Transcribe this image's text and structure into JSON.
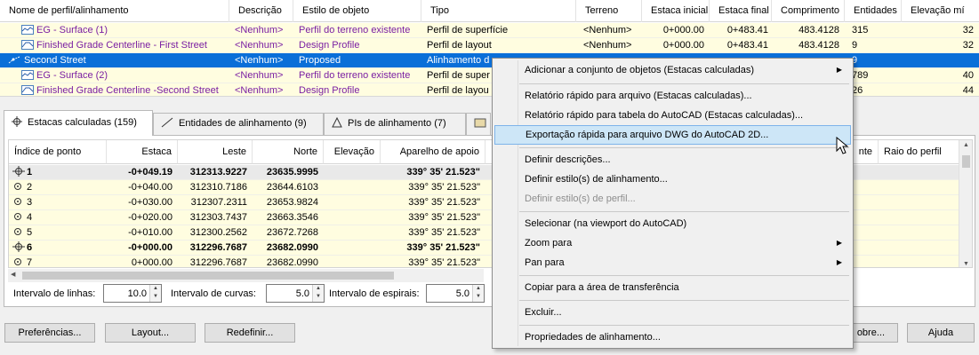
{
  "top_grid": {
    "columns": [
      "Nome de perfil/alinhamento",
      "Descrição",
      "Estilo de objeto",
      "Tipo",
      "Terreno",
      "Estaca inicial",
      "Estaca final",
      "Comprimento",
      "Entidades",
      "Elevação mí"
    ],
    "rows": [
      {
        "name": "EG - Surface (1)",
        "desc": "<Nenhum>",
        "style": "Perfil do terreno existente",
        "type": "Perfil de superfície",
        "terrain": "<Nenhum>",
        "start": "0+000.00",
        "end": "0+483.41",
        "length": "483.4128",
        "entities": "315",
        "elev": "32"
      },
      {
        "name": "Finished Grade Centerline - First Street",
        "desc": "<Nenhum>",
        "style": "Design Profile",
        "type": "Perfil de layout",
        "terrain": "<Nenhum>",
        "start": "0+000.00",
        "end": "0+483.41",
        "length": "483.4128",
        "entities": "9",
        "elev": "32"
      },
      {
        "name": "Second Street",
        "desc": "<Nenhum>",
        "style": "Proposed",
        "type": "Alinhamento d",
        "terrain": "",
        "start": "",
        "end": "",
        "length": "",
        "entities": "9",
        "elev": ""
      },
      {
        "name": "EG - Surface (2)",
        "desc": "<Nenhum>",
        "style": "Perfil do terreno existente",
        "type": "Perfil de super",
        "terrain": "",
        "start": "",
        "end": "",
        "length": "",
        "entities": "789",
        "elev": "40"
      },
      {
        "name": "Finished Grade Centerline -Second Street",
        "desc": "<Nenhum>",
        "style": "Design Profile",
        "type": "Perfil de layou",
        "terrain": "",
        "start": "",
        "end": "",
        "length": "",
        "entities": "26",
        "elev": "44"
      }
    ]
  },
  "tabs": [
    {
      "label": "Estacas calculadas (159)"
    },
    {
      "label": "Entidades de alinhamento (9)"
    },
    {
      "label": "PIs de alinhamento (7)"
    }
  ],
  "bottom_grid": {
    "columns": [
      "Índice de ponto",
      "Estaca",
      "Leste",
      "Norte",
      "Elevação",
      "Aparelho de apoio",
      "nte",
      "Raio do perfil"
    ],
    "rows": [
      {
        "index": "1",
        "station": "-0+049.19",
        "east": "312313.9227",
        "north": "23635.9995",
        "elev": "",
        "bearing": "339° 35' 21.523\"",
        "bold": true
      },
      {
        "index": "2",
        "station": "-0+040.00",
        "east": "312310.7186",
        "north": "23644.6103",
        "elev": "",
        "bearing": "339° 35' 21.523\"",
        "bold": false
      },
      {
        "index": "3",
        "station": "-0+030.00",
        "east": "312307.2311",
        "north": "23653.9824",
        "elev": "",
        "bearing": "339° 35' 21.523\"",
        "bold": false
      },
      {
        "index": "4",
        "station": "-0+020.00",
        "east": "312303.7437",
        "north": "23663.3546",
        "elev": "",
        "bearing": "339° 35' 21.523\"",
        "bold": false
      },
      {
        "index": "5",
        "station": "-0+010.00",
        "east": "312300.2562",
        "north": "23672.7268",
        "elev": "",
        "bearing": "339° 35' 21.523\"",
        "bold": false
      },
      {
        "index": "6",
        "station": "-0+000.00",
        "east": "312296.7687",
        "north": "23682.0990",
        "elev": "",
        "bearing": "339° 35' 21.523\"",
        "bold": true
      },
      {
        "index": "7",
        "station": "0+000.00",
        "east": "312296.7687",
        "north": "23682.0990",
        "elev": "",
        "bearing": "339° 35' 21.523\"",
        "bold": false
      }
    ]
  },
  "intervals": {
    "lines_label": "Intervalo de linhas:",
    "lines_value": "10.0",
    "curves_label": "Intervalo de curvas:",
    "curves_value": "5.0",
    "spirals_label": "Intervalo de espirais:",
    "spirals_value": "5.0"
  },
  "buttons": {
    "preferences": "Preferências...",
    "layout": "Layout...",
    "reset": "Redefinir...",
    "about": "obre...",
    "help": "Ajuda"
  },
  "context_menu": {
    "items": [
      {
        "label": "Adicionar a conjunto de objetos (Estacas calculadas)",
        "submenu": true,
        "disabled": false
      },
      {
        "label": "Relatório rápido para arquivo (Estacas calculadas)...",
        "submenu": false,
        "disabled": false
      },
      {
        "label": "Relatório rápido para tabela do AutoCAD (Estacas calculadas)...",
        "submenu": false,
        "disabled": false
      },
      {
        "label": "Exportação rápida para arquivo DWG do AutoCAD 2D...",
        "submenu": false,
        "disabled": false,
        "highlight": true
      },
      {
        "label": "Definir descrições...",
        "submenu": false,
        "disabled": false
      },
      {
        "label": "Definir estilo(s) de alinhamento...",
        "submenu": false,
        "disabled": false
      },
      {
        "label": "Definir estilo(s) de perfil...",
        "submenu": false,
        "disabled": true
      },
      {
        "label": "Selecionar (na viewport do AutoCAD)",
        "submenu": false,
        "disabled": false
      },
      {
        "label": "Zoom para",
        "submenu": true,
        "disabled": false
      },
      {
        "label": "Pan para",
        "submenu": true,
        "disabled": false
      },
      {
        "label": "Copiar para a área de transferência",
        "submenu": false,
        "disabled": false
      },
      {
        "label": "Excluir...",
        "submenu": false,
        "disabled": false
      },
      {
        "label": "Propriedades de alinhamento...",
        "submenu": false,
        "disabled": false
      }
    ]
  },
  "colors": {
    "selection": "#0a6fd8",
    "row_bg": "#fffde0",
    "link_purple": "#7a1fa2",
    "menu_highlight": "#cde6f7"
  }
}
